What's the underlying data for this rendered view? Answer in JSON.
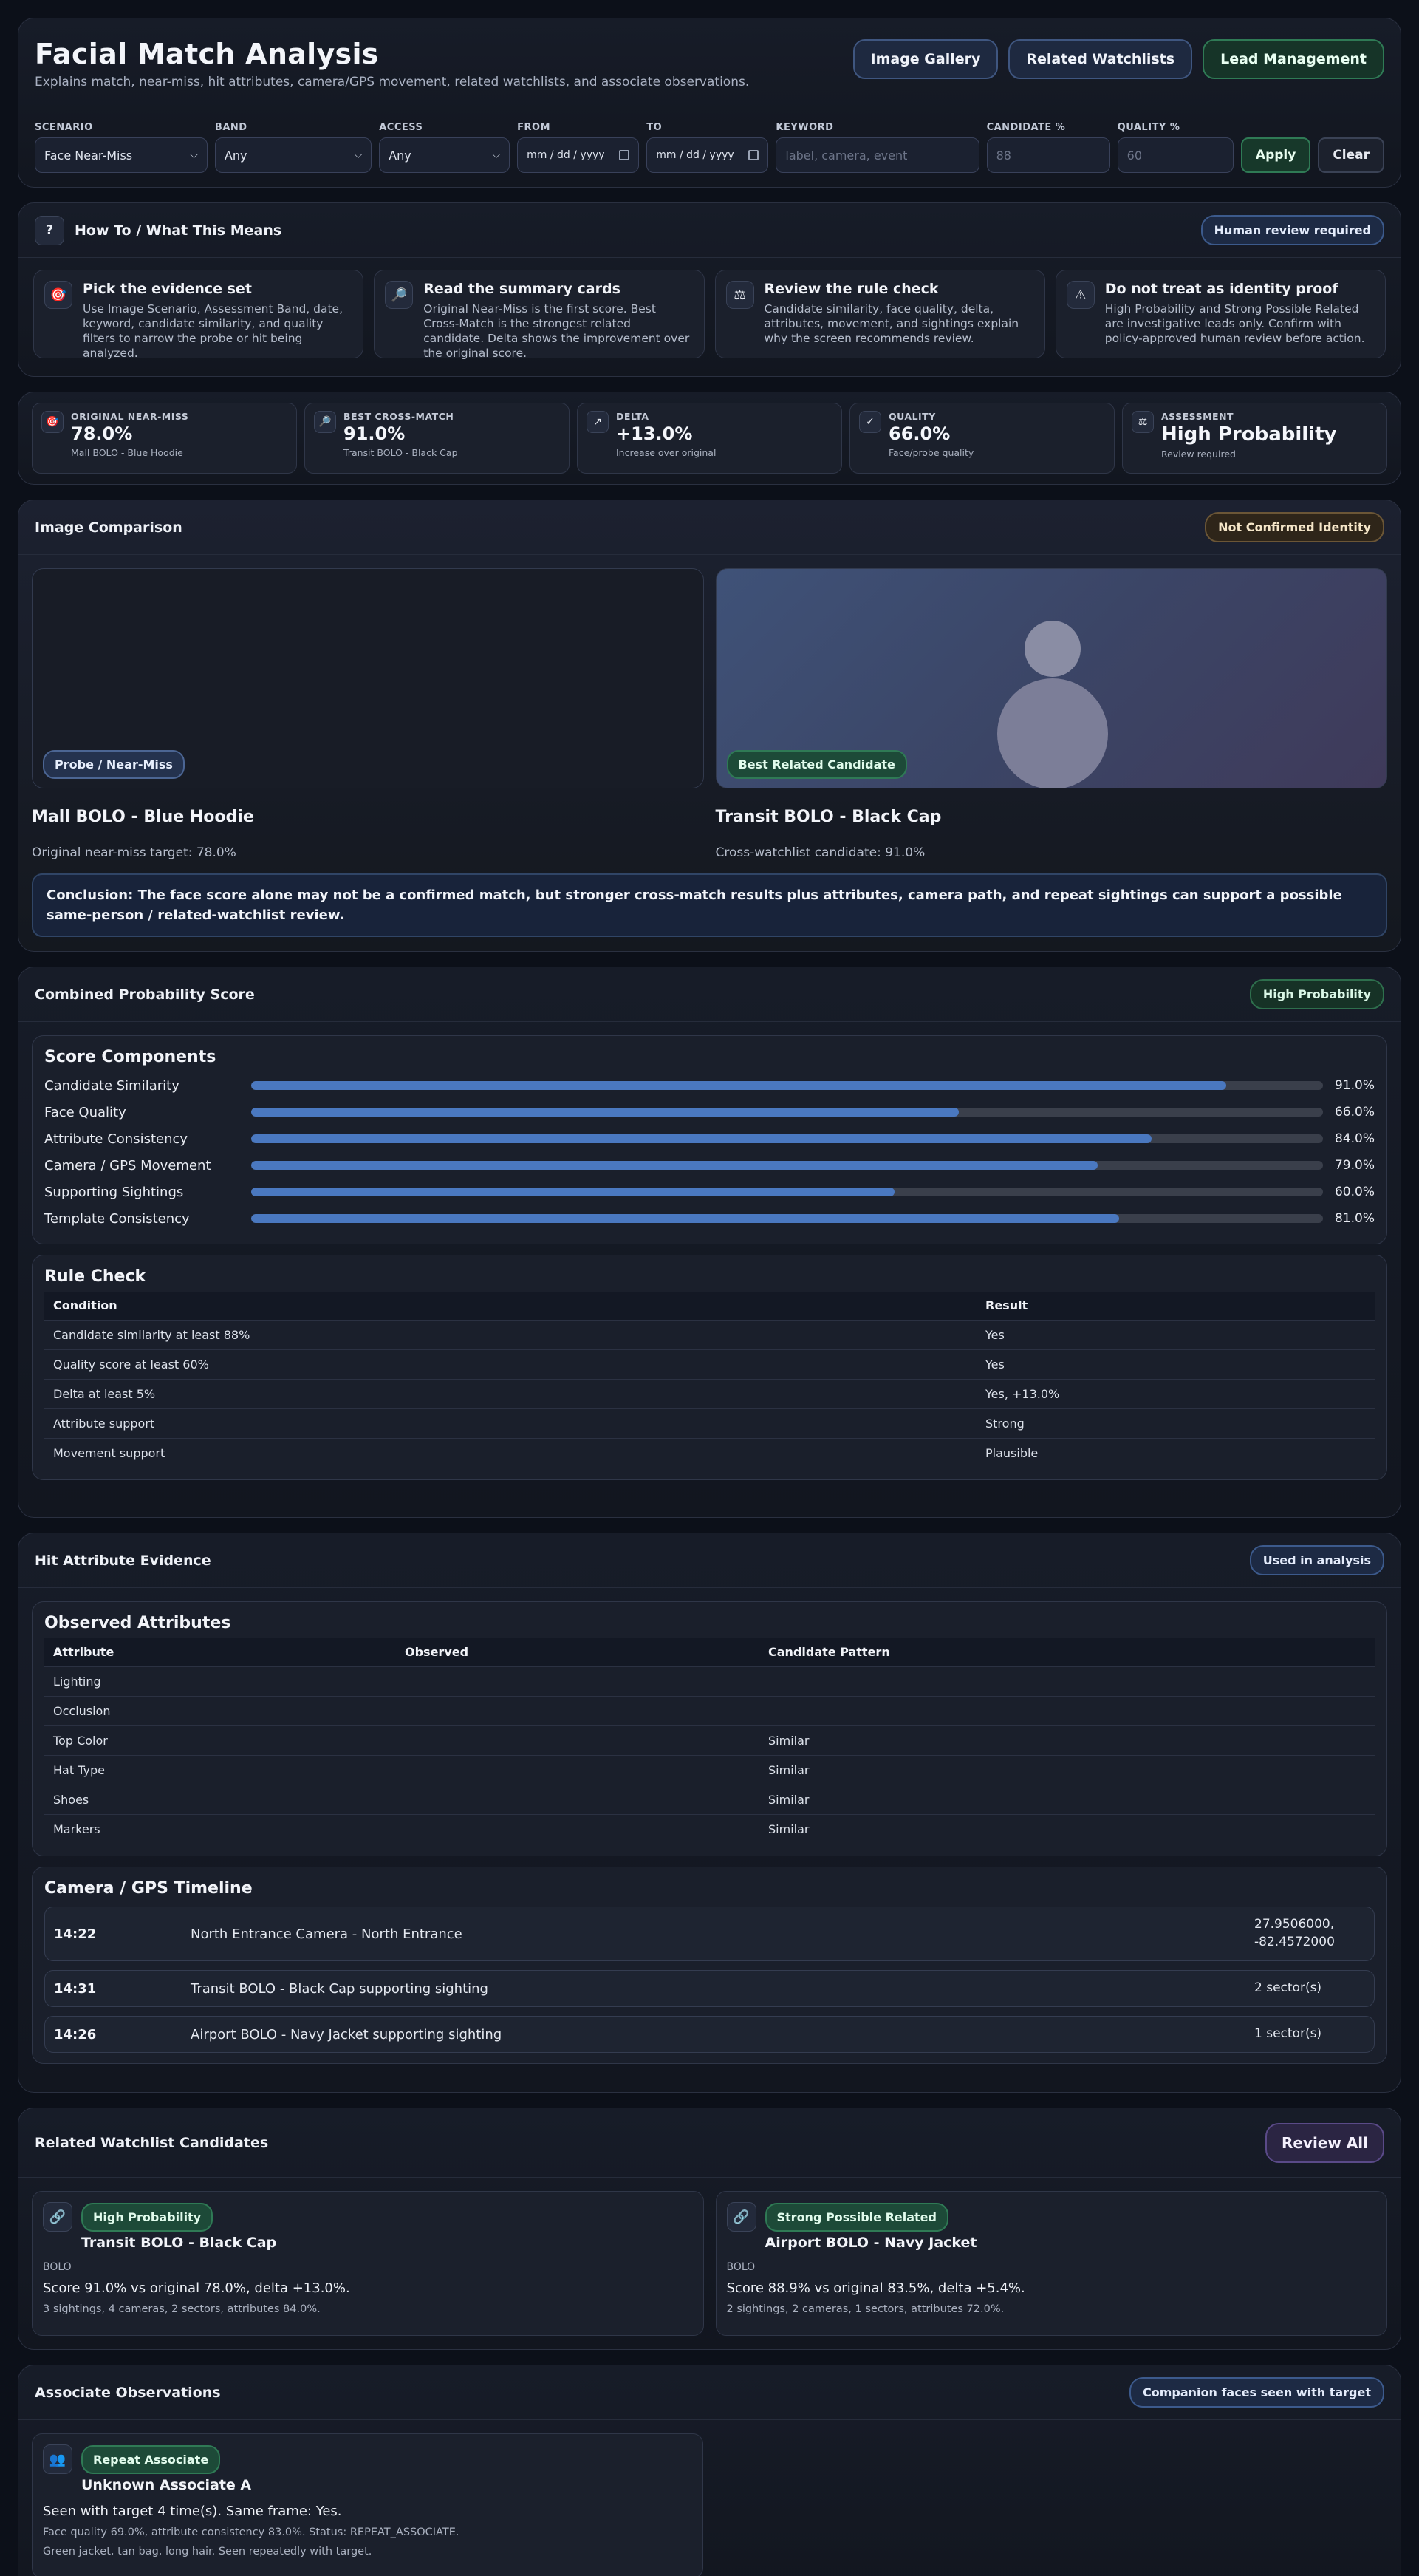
{
  "header": {
    "title": "Facial Match Analysis",
    "subtitle": "Explains match, near-miss, hit attributes, camera/GPS movement, related watchlists, and associate observations.",
    "nav": [
      "Image Gallery",
      "Related Watchlists",
      "Lead Management"
    ]
  },
  "filters": {
    "scenario_label": "SCENARIO",
    "scenario_value": "Face Near-Miss",
    "band_label": "BAND",
    "band_value": "Any",
    "access_label": "ACCESS",
    "access_value": "Any",
    "from_label": "FROM",
    "from_value": "mm / dd / yyyy",
    "to_label": "TO",
    "to_value": "mm / dd / yyyy",
    "keyword_label": "KEYWORD",
    "keyword_placeholder": "label, camera, event",
    "candidate_label": "CANDIDATE %",
    "candidate_placeholder": "88",
    "quality_label": "QUALITY %",
    "quality_placeholder": "60",
    "apply": "Apply",
    "clear": "Clear"
  },
  "howto": {
    "title": "How To / What This Means",
    "icon": "?",
    "badge": "Human review required",
    "steps": [
      {
        "icon": "🎯",
        "title": "Pick the evidence set",
        "text": "Use Image Scenario, Assessment Band, date, keyword, candidate similarity, and quality filters to narrow the probe or hit being analyzed."
      },
      {
        "icon": "🔎",
        "title": "Read the summary cards",
        "text": "Original Near-Miss is the first score. Best Cross-Match is the strongest related candidate. Delta shows the improvement over the original score."
      },
      {
        "icon": "⚖",
        "title": "Review the rule check",
        "text": "Candidate similarity, face quality, delta, attributes, movement, and sightings explain why the screen recommends review."
      },
      {
        "icon": "⚠",
        "title": "Do not treat as identity proof",
        "text": "High Probability and Strong Possible Related are investigative leads only. Confirm with policy-approved human review before action."
      }
    ]
  },
  "metrics": [
    {
      "icon": "🎯",
      "label": "ORIGINAL NEAR-MISS",
      "value": "78.0%",
      "sub": "Mall BOLO - Blue Hoodie"
    },
    {
      "icon": "🔎",
      "label": "BEST CROSS-MATCH",
      "value": "91.0%",
      "sub": "Transit BOLO - Black Cap"
    },
    {
      "icon": "↗",
      "label": "DELTA",
      "value": "+13.0%",
      "sub": "Increase over original"
    },
    {
      "icon": "✓",
      "label": "QUALITY",
      "value": "66.0%",
      "sub": "Face/probe quality"
    },
    {
      "icon": "⚖",
      "label": "ASSESSMENT",
      "value": "High Probability",
      "sub": "Review required"
    }
  ],
  "comparison": {
    "title": "Image Comparison",
    "badge": "Not Confirmed Identity",
    "probe_tag": "Probe / Near-Miss",
    "candidate_tag": "Best Related Candidate",
    "probe_name": "Mall BOLO - Blue Hoodie",
    "probe_detail": "Original near-miss target: 78.0%",
    "candidate_name": "Transit BOLO - Black Cap",
    "candidate_detail": "Cross-watchlist candidate: 91.0%",
    "conclusion": "Conclusion: The face score alone may not be a confirmed match, but stronger cross-match results plus attributes, camera path, and repeat sightings can support a possible same-person / related-watchlist review."
  },
  "combined": {
    "title": "Combined Probability Score",
    "badge": "High Probability",
    "components_title": "Score Components",
    "components": [
      {
        "label": "Candidate Similarity",
        "value": 91.0,
        "display": "91.0%"
      },
      {
        "label": "Face Quality",
        "value": 66.0,
        "display": "66.0%"
      },
      {
        "label": "Attribute Consistency",
        "value": 84.0,
        "display": "84.0%"
      },
      {
        "label": "Camera / GPS Movement",
        "value": 79.0,
        "display": "79.0%"
      },
      {
        "label": "Supporting Sightings",
        "value": 60.0,
        "display": "60.0%"
      },
      {
        "label": "Template Consistency",
        "value": 81.0,
        "display": "81.0%"
      }
    ],
    "rule_title": "Rule Check",
    "rule_headers": [
      "Condition",
      "Result"
    ],
    "rules": [
      [
        "Candidate similarity at least 88%",
        "Yes"
      ],
      [
        "Quality score at least 60%",
        "Yes"
      ],
      [
        "Delta at least 5%",
        "Yes, +13.0%"
      ],
      [
        "Attribute support",
        "Strong"
      ],
      [
        "Movement support",
        "Plausible"
      ]
    ]
  },
  "attributes": {
    "title": "Hit Attribute Evidence",
    "badge": "Used in analysis",
    "observed_title": "Observed Attributes",
    "headers": [
      "Attribute",
      "Observed",
      "Candidate Pattern"
    ],
    "rows": [
      [
        "Lighting",
        "",
        ""
      ],
      [
        "Occlusion",
        "",
        ""
      ],
      [
        "Top Color",
        "",
        "Similar"
      ],
      [
        "Hat Type",
        "",
        "Similar"
      ],
      [
        "Shoes",
        "",
        "Similar"
      ],
      [
        "Markers",
        "",
        "Similar"
      ]
    ],
    "timeline_title": "Camera / GPS Timeline",
    "timeline": [
      {
        "time": "14:22",
        "desc": "North Entrance Camera - North Entrance",
        "right1": "27.9506000,",
        "right2": "-82.4572000"
      },
      {
        "time": "14:31",
        "desc": "Transit BOLO - Black Cap supporting sighting",
        "right1": "2 sector(s)",
        "right2": ""
      },
      {
        "time": "14:26",
        "desc": "Airport BOLO - Navy Jacket supporting sighting",
        "right1": "1 sector(s)",
        "right2": ""
      }
    ]
  },
  "related": {
    "title": "Related Watchlist Candidates",
    "button": "Review All",
    "cards": [
      {
        "icon": "🔗",
        "badge": "High Probability",
        "name": "Transit BOLO - Black Cap",
        "type": "BOLO",
        "score": "Score 91.0% vs original 78.0%, delta +13.0%.",
        "foot": "3 sightings, 4 cameras, 2 sectors, attributes 84.0%."
      },
      {
        "icon": "🔗",
        "badge": "Strong Possible Related",
        "name": "Airport BOLO - Navy Jacket",
        "type": "BOLO",
        "score": "Score 88.9% vs original 83.5%, delta +5.4%.",
        "foot": "2 sightings, 2 cameras, 1 sectors, attributes 72.0%."
      }
    ]
  },
  "associates": {
    "title": "Associate Observations",
    "badge": "Companion faces seen with target",
    "card": {
      "icon": "👥",
      "badge": "Repeat Associate",
      "name": "Unknown Associate A",
      "seen": "Seen with target 4 time(s). Same frame: Yes.",
      "detail": "Face quality 69.0%, attribute consistency 83.0%. Status: REPEAT_ASSOCIATE.",
      "note": "Green jacket, tan bag, long hair. Seen repeatedly with target."
    }
  }
}
